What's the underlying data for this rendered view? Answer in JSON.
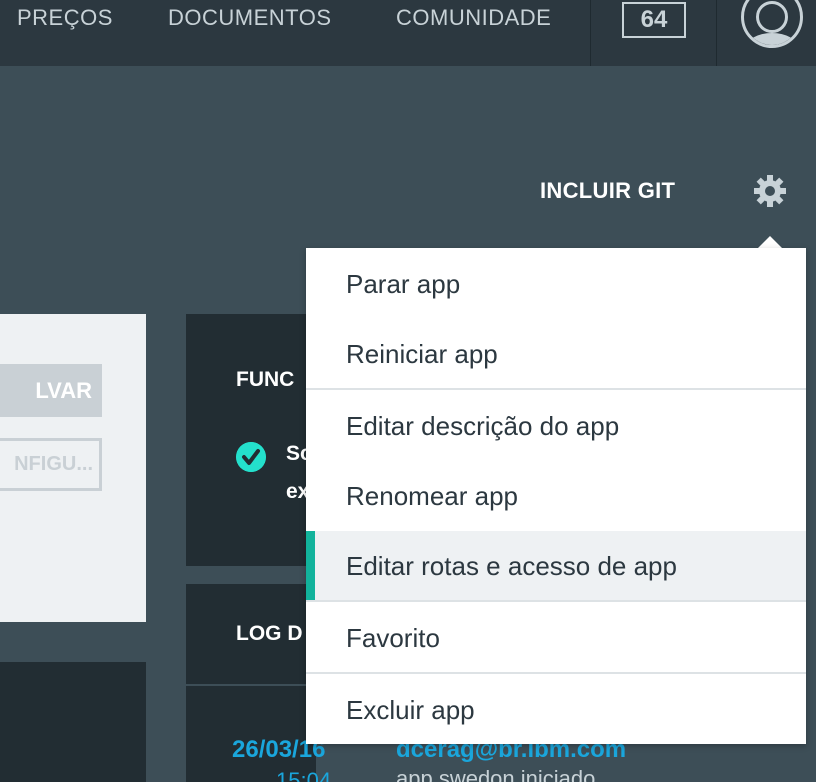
{
  "nav": {
    "links": [
      "PREÇOS",
      "DOCUMENTOS",
      "COMUNIDADE"
    ],
    "badge_count": "64",
    "icons": [
      "avatar-icon",
      "gear-icon",
      "checkmark-icon"
    ]
  },
  "header": {
    "git_label": "INCLUIR GIT"
  },
  "left_card": {
    "primary_button": "LVAR",
    "secondary_button": "NFIGU..."
  },
  "status_card": {
    "title": "FUNC",
    "line1": "So",
    "line2": "ex"
  },
  "log_card": {
    "title": "LOG D",
    "date": "26/03/16",
    "time": "15:04",
    "user": "dcerag@br.ibm.com",
    "message": "app swedon iniciado"
  },
  "menu": {
    "items": [
      "Parar app",
      "Reiniciar app",
      "Editar descrição do app",
      "Renomear app",
      "Editar rotas e acesso de app",
      "Favorito",
      "Excluir app"
    ],
    "active_index": 4
  },
  "colors": {
    "accent": "#12b39c",
    "link": "#1aa6dc",
    "check": "#24e0cc"
  }
}
